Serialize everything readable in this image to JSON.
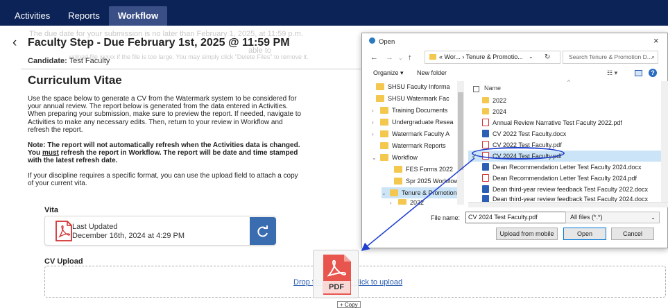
{
  "nav": {
    "tabs": [
      "Activities",
      "Reports",
      "Workflow"
    ],
    "active": "Workflow"
  },
  "ghost_lines": [
    "The due date for your submission is no later than February 1, 2025, at 11:59 p.m.",
    "able to",
    "upload file xxxxx if the file is too large. You may simply click \"Delete Files\" to remove it."
  ],
  "header": {
    "back_icon": "‹",
    "step_title": "Faculty Step - Due February 1st, 2025 @ 11:59 PM",
    "candidate_label": "Candidate:",
    "candidate_name": "Test Faculty"
  },
  "section": {
    "title": "Curriculum Vitae",
    "intro": "Use the space below to generate a CV from the Watermark system to be considered for your annual review. The report below is generated from the data entered in Activities. When preparing your submission, make sure to preview the report. If needed, navigate to Activities to make any necessary edits. Then, return to your review in Workflow and refresh the report.",
    "note_prefix": "Note: The report will not automatically refresh when the Activities data is changed. You ",
    "note_emph": "must",
    "note_suffix": " refresh the report in Workflow. The report will be date and time stamped with the latest refresh date.",
    "format_note": "If your discipline requires a specific format, you can use the upload field to attach a copy of your current vita."
  },
  "vita": {
    "label": "Vita",
    "last_updated_label": "Last Updated",
    "last_updated_value": "December 16th, 2024 at 4:29 PM",
    "refresh_icon": "refresh-icon"
  },
  "cv_upload": {
    "label": "CV Upload",
    "drop_text": "Drop files here or click to upload",
    "drag_icon_label": "PDF",
    "copy_tip": "+ Copy"
  },
  "dialog": {
    "title": "Open",
    "address_parts": "« Wor...  ›  Tenure & Promotio...",
    "search_placeholder": "Search Tenure & Promotion D...",
    "organize": "Organize ▾",
    "new_folder": "New folder",
    "column_name": "Name",
    "tree": [
      {
        "label": "SHSU Faculty Informa",
        "caret": ""
      },
      {
        "label": "SHSU Watermark Fac",
        "caret": ""
      },
      {
        "label": "Training Documents",
        "caret": "›"
      },
      {
        "label": "Undergraduate Resea",
        "caret": "›"
      },
      {
        "label": "Watermark Faculty A",
        "caret": "›"
      },
      {
        "label": "Watermark Reports",
        "caret": ""
      },
      {
        "label": "Workflow",
        "caret": "⌄"
      },
      {
        "label": "FES Forms 2022",
        "caret": ""
      },
      {
        "label": "Spr 2025 Workflow",
        "caret": ""
      },
      {
        "label": "Tenure & Promotion",
        "caret": "⌄"
      },
      {
        "label": "2022",
        "caret": "›"
      }
    ],
    "files": [
      {
        "name": "2022",
        "type": "folder"
      },
      {
        "name": "2024",
        "type": "folder"
      },
      {
        "name": "Annual Review Narrative Test Faculty 2022.pdf",
        "type": "pdf"
      },
      {
        "name": "CV 2022 Test Faculty.docx",
        "type": "doc"
      },
      {
        "name": "CV 2022 Test Faculty.pdf",
        "type": "pdf"
      },
      {
        "name": "CV 2024 Test Faculty.pdf",
        "type": "pdf",
        "selected": true
      },
      {
        "name": "Dean Recommendation Letter Test Faculty 2024.docx",
        "type": "doc"
      },
      {
        "name": "Dean Recommendation Letter Test Faculty 2024.pdf",
        "type": "pdf"
      },
      {
        "name": "Dean third-year review feedback Test Faculty 2022.docx",
        "type": "doc"
      },
      {
        "name": "Dean third-year review feedback Test Faculty 2024.docx",
        "type": "doc"
      }
    ],
    "file_name_label": "File name:",
    "file_name_value": "CV 2024 Test Faculty.pdf",
    "file_type": "All files (*.*)",
    "btn_mobile": "Upload from mobile",
    "btn_open": "Open",
    "btn_cancel": "Cancel",
    "close_icon": "×"
  },
  "colors": {
    "nav_bg": "#0c2357",
    "refresh_btn": "#3a6cb0",
    "link": "#2a5db0",
    "pdf_red": "#d32f2f",
    "arrow": "#1f3fd0"
  }
}
